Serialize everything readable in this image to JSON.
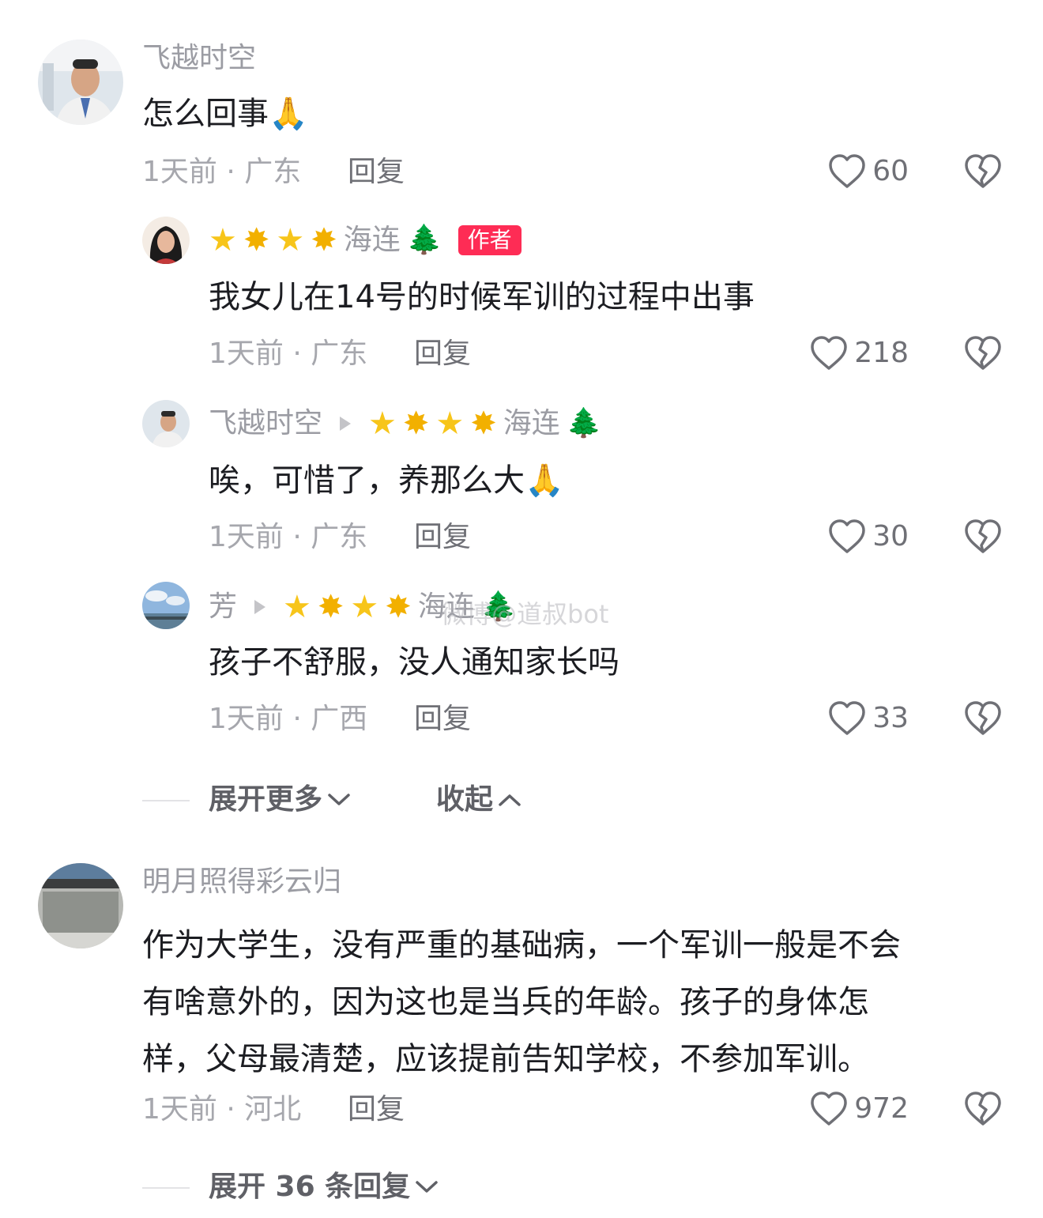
{
  "comments": [
    {
      "author": "飞越时空",
      "text": "怎么回事",
      "emoji": "🙏",
      "time": "1天前",
      "location": "广东",
      "reply_label": "回复",
      "likes": "60",
      "replies": [
        {
          "author_stars": "⭐🌟⭐🌟",
          "author": "海连",
          "author_emoji": "🌲",
          "badge": "作者",
          "text": "我女儿在14号的时候军训的过程中出事",
          "time": "1天前",
          "location": "广东",
          "reply_label": "回复",
          "likes": "218"
        },
        {
          "author": "飞越时空",
          "reply_to_stars": "⭐🌟⭐🌟",
          "reply_to": "海连",
          "reply_to_emoji": "🌲",
          "text": "唉，可惜了，养那么大",
          "emoji": "🙏",
          "time": "1天前",
          "location": "广东",
          "reply_label": "回复",
          "likes": "30"
        },
        {
          "author": "芳",
          "reply_to_stars": "⭐🌟⭐🌟",
          "reply_to": "海连",
          "reply_to_emoji": "🌲",
          "text": "孩子不舒服，没人通知家长吗",
          "time": "1天前",
          "location": "广西",
          "reply_label": "回复",
          "likes": "33"
        }
      ],
      "expand_more": "展开更多",
      "collapse": "收起"
    },
    {
      "author": "明月照得彩云归",
      "text_lines": [
        "作为大学生，没有严重的基础病，一个军训一般是不会",
        "有啥意外的，因为这也是当兵的年龄。孩子的身体怎",
        "样，父母最清楚，应该提前告知学校，不参加军训。"
      ],
      "time": "1天前",
      "location": "河北",
      "reply_label": "回复",
      "likes": "972",
      "expand_replies": "展开 36 条回复"
    }
  ],
  "watermark": "微博@道叔bot",
  "separator": "·",
  "icons": {
    "like": "heart-outline-icon",
    "dislike": "broken-heart-icon",
    "chevron_down": "chevron-down-icon",
    "chevron_up": "chevron-up-icon",
    "reply_arrow": "play-arrow-icon"
  },
  "colors": {
    "author_badge": "#fe2c55",
    "muted": "#a6a7ad"
  }
}
